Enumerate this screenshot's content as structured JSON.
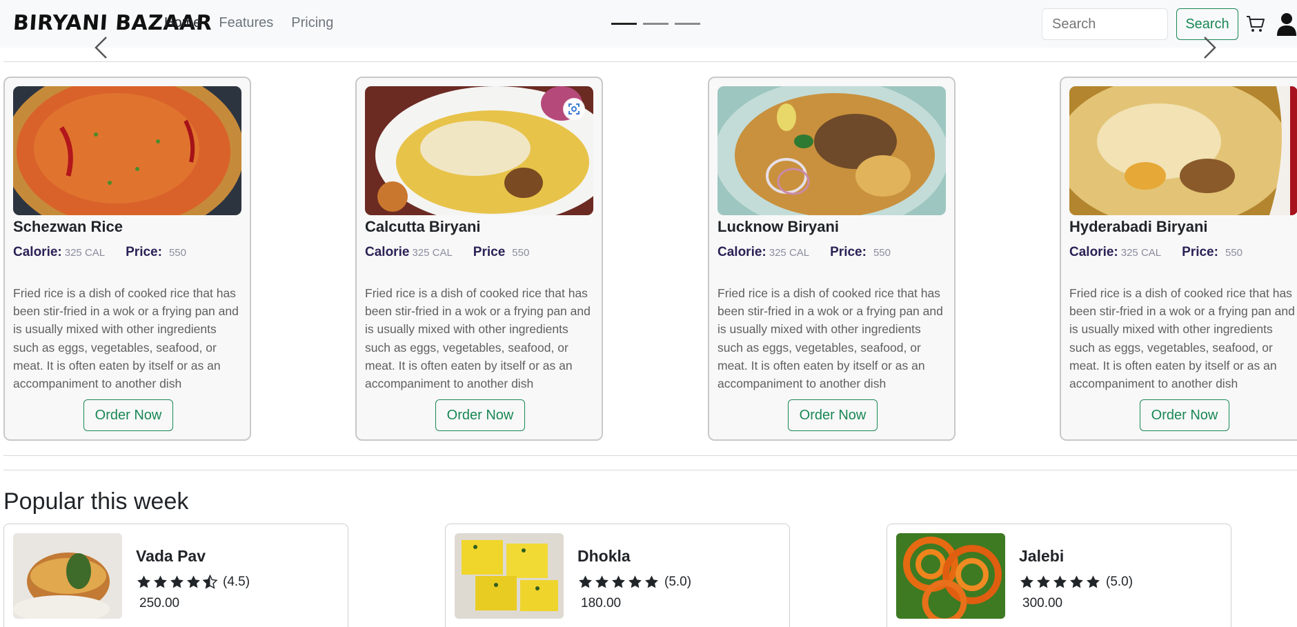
{
  "navbar": {
    "brand": "BIRYANI BAZAAR",
    "links": [
      {
        "label": "Home",
        "active": true
      },
      {
        "label": "Features",
        "active": false
      },
      {
        "label": "Pricing",
        "active": false
      }
    ],
    "search_placeholder": "Search",
    "search_button": "Search",
    "carousel_indicators": 3,
    "active_indicator": 0
  },
  "cards": [
    {
      "title": "Schezwan Rice",
      "calorie_label": "Calorie:",
      "calorie_value": "325 CAL",
      "price_label": "Price:",
      "price_value": "550",
      "description": "Fried rice is a dish of cooked rice that has been stir-fried in a wok or a frying pan and is usually mixed with other ingredients such as eggs, vegetables, seafood, or meat. It is often eaten by itself or as an accompaniment to another dish",
      "button": "Order Now",
      "image": "schezwan-rice-photo"
    },
    {
      "title": "Calcutta Biryani",
      "calorie_label": "Calorie",
      "calorie_value": "325 CAL",
      "price_label": "Price",
      "price_value": "550",
      "description": "Fried rice is a dish of cooked rice that has been stir-fried in a wok or a frying pan and is usually mixed with other ingredients such as eggs, vegetables, seafood, or meat. It is often eaten by itself or as an accompaniment to another dish",
      "button": "Order Now",
      "image": "calcutta-biryani-photo"
    },
    {
      "title": "Lucknow Biryani",
      "calorie_label": "Calorie:",
      "calorie_value": "325 CAL",
      "price_label": "Price:",
      "price_value": "550",
      "description": "Fried rice is a dish of cooked rice that has been stir-fried in a wok or a frying pan and is usually mixed with other ingredients such as eggs, vegetables, seafood, or meat. It is often eaten by itself or as an accompaniment to another dish",
      "button": "Order Now",
      "image": "lucknow-biryani-photo"
    },
    {
      "title": "Hyderabadi Biryani",
      "calorie_label": "Calorie:",
      "calorie_value": "325 CAL",
      "price_label": "Price:",
      "price_value": "550",
      "description": "Fried rice is a dish of cooked rice that has been stir-fried in a wok or a frying pan and is usually mixed with other ingredients such as eggs, vegetables, seafood, or meat. It is often eaten by itself or as an accompaniment to another dish",
      "button": "Order Now",
      "image": "hyderabadi-biryani-photo"
    }
  ],
  "popular": {
    "heading": "Popular this week",
    "items": [
      {
        "name": "Vada Pav",
        "rating": 4.5,
        "rating_text": "(4.5)",
        "price": "250.00",
        "image": "vada-pav-photo"
      },
      {
        "name": "Dhokla",
        "rating": 5.0,
        "rating_text": "(5.0)",
        "price": "180.00",
        "image": "dhokla-photo"
      },
      {
        "name": "Jalebi",
        "rating": 5.0,
        "rating_text": "(5.0)",
        "price": "300.00",
        "image": "jalebi-photo"
      }
    ]
  },
  "colors": {
    "accent_green": "#198754",
    "meta_label": "#2b2156",
    "navbar_bg": "#f8f9fa"
  }
}
